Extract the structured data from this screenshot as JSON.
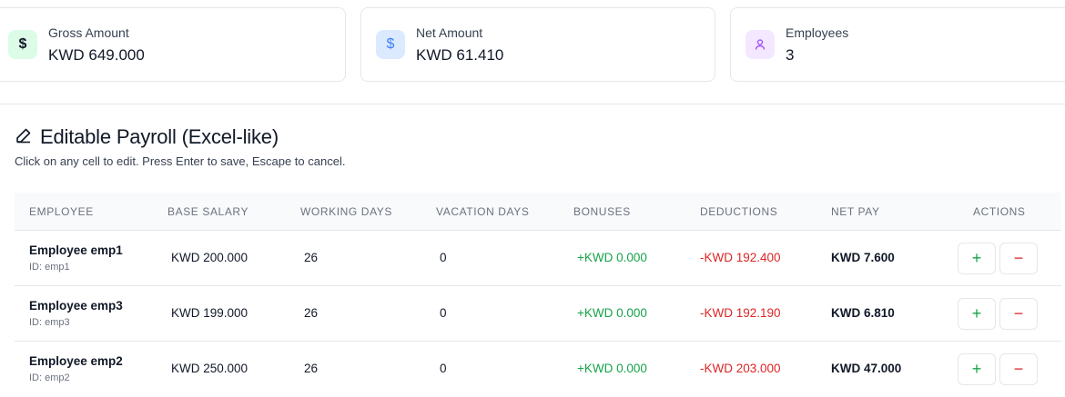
{
  "summary": {
    "gross": {
      "label": "Gross Amount",
      "value": "KWD 649.000",
      "icon": "dollar-icon"
    },
    "net": {
      "label": "Net Amount",
      "value": "KWD 61.410",
      "icon": "dollar-icon"
    },
    "employees": {
      "label": "Employees",
      "value": "3",
      "icon": "user-icon"
    }
  },
  "section": {
    "title": "Editable Payroll (Excel-like)",
    "subtitle": "Click on any cell to edit. Press Enter to save, Escape to cancel.",
    "icon": "pencil-icon"
  },
  "table": {
    "headers": {
      "employee": "EMPLOYEE",
      "base_salary": "BASE SALARY",
      "working_days": "WORKING DAYS",
      "vacation_days": "VACATION DAYS",
      "bonuses": "BONUSES",
      "deductions": "DEDUCTIONS",
      "net_pay": "NET PAY",
      "actions": "ACTIONS"
    },
    "rows": [
      {
        "name": "Employee emp1",
        "id": "ID: emp1",
        "base_salary": "KWD 200.000",
        "working_days": "26",
        "vacation_days": "0",
        "bonuses": "+KWD 0.000",
        "deductions": "-KWD 192.400",
        "net_pay": "KWD 7.600"
      },
      {
        "name": "Employee emp3",
        "id": "ID: emp3",
        "base_salary": "KWD 199.000",
        "working_days": "26",
        "vacation_days": "0",
        "bonuses": "+KWD 0.000",
        "deductions": "-KWD 192.190",
        "net_pay": "KWD 6.810"
      },
      {
        "name": "Employee emp2",
        "id": "ID: emp2",
        "base_salary": "KWD 250.000",
        "working_days": "26",
        "vacation_days": "0",
        "bonuses": "+KWD 0.000",
        "deductions": "-KWD 203.000",
        "net_pay": "KWD 47.000"
      }
    ],
    "action_icons": {
      "add": "plus-icon",
      "remove": "minus-icon"
    }
  },
  "colors": {
    "positive": "#16a34a",
    "negative": "#dc2626",
    "header_bg": "#f9fafb",
    "border": "#e5e7eb"
  }
}
